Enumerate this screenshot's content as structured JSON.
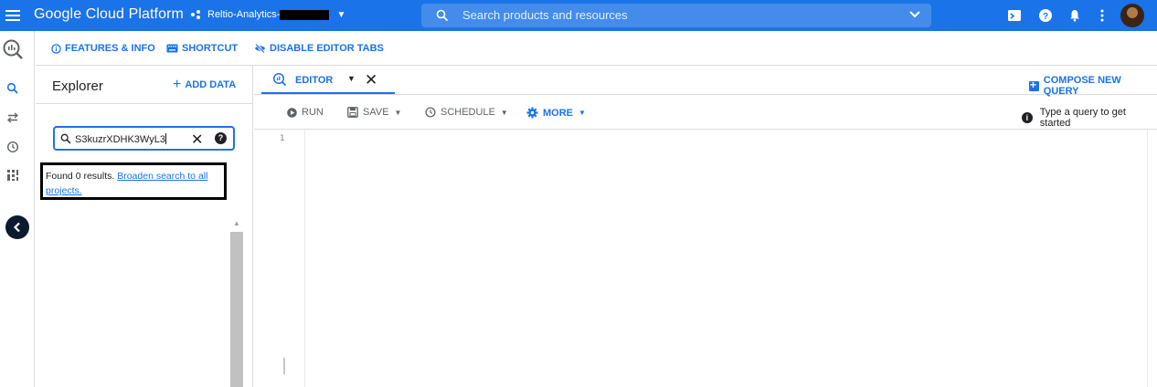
{
  "topbar": {
    "brand": "Google Cloud Platform",
    "project_name": "Reltio-Analytics-",
    "search_placeholder": "Search products and resources"
  },
  "subbar": {
    "features_label": "FEATURES & INFO",
    "shortcut_label": "SHORTCUT",
    "disable_tabs_label": "DISABLE EDITOR TABS"
  },
  "explorer": {
    "title": "Explorer",
    "add_data_label": "ADD DATA",
    "filter_value": "S3kuzrXDHK3WyL3",
    "results_text": "Found 0 results.",
    "broaden_link": "Broaden search to all projects."
  },
  "editor": {
    "tab_label": "EDITOR",
    "compose_label": "COMPOSE NEW QUERY",
    "run_label": "RUN",
    "save_label": "SAVE",
    "schedule_label": "SCHEDULE",
    "more_label": "MORE",
    "hint_text": "Type a query to get started",
    "line_number": "1"
  },
  "colors": {
    "accent": "#1a73e8",
    "topbar": "#1a73e8",
    "border": "#dadce0"
  }
}
